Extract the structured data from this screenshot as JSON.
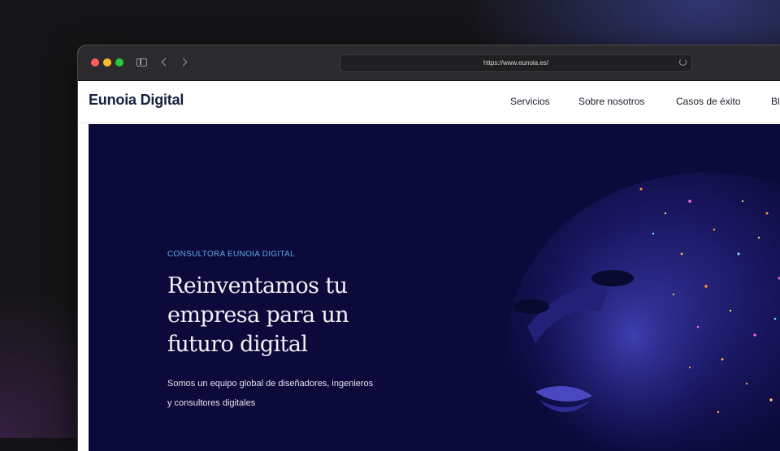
{
  "browser": {
    "url": "https://www.eunoia.es/",
    "icons": [
      "close-dot",
      "minimize-dot",
      "zoom-dot",
      "sidebar-icon",
      "back-chevron",
      "forward-chevron",
      "reload-icon"
    ]
  },
  "site": {
    "logo": "Eunoia Digital",
    "nav": [
      "Servicios",
      "Sobre nosotros",
      "Casos de éxito",
      "Bl"
    ]
  },
  "hero": {
    "eyebrow": "CONSULTORA EUNOIA DIGITAL",
    "headline": "Reinventamos tu empresa para un futuro digital",
    "subtitle": "Somos un equipo global de diseñadores, ingenieros y consultores digitales"
  },
  "colors": {
    "hero_bg": "#0b0a3a",
    "accent": "#5aa7e6",
    "logo": "#16213e"
  }
}
